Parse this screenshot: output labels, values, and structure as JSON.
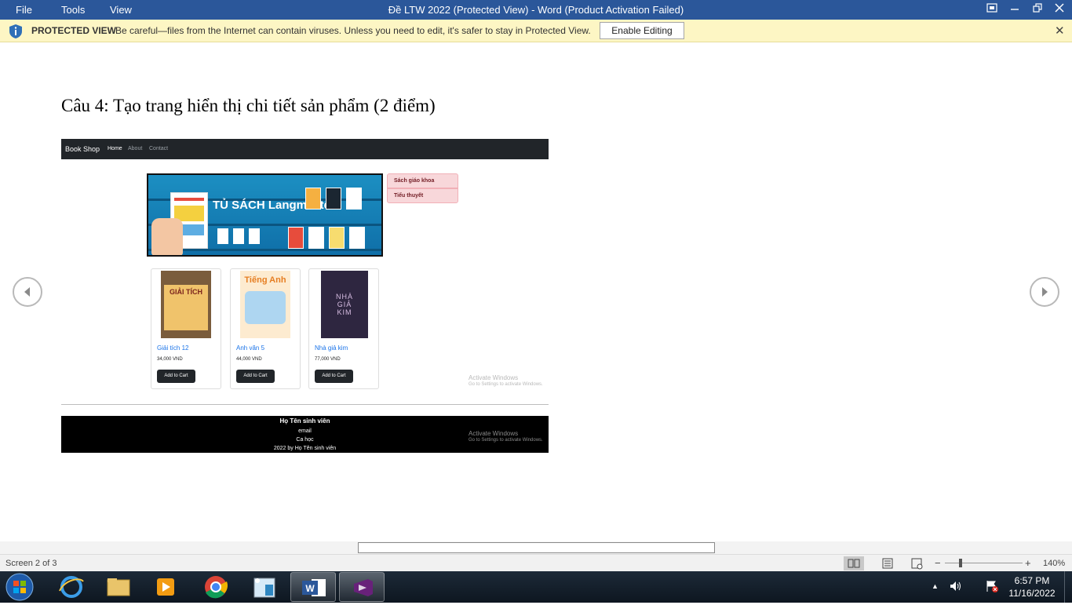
{
  "titlebar": {
    "menu": [
      "File",
      "Tools",
      "View"
    ],
    "title": "Đề LTW 2022 (Protected View) - Word (Product Activation Failed)"
  },
  "protected_view": {
    "label": "PROTECTED VIEW",
    "message": "Be careful—files from the Internet can contain viruses. Unless you need to edit, it's safer to stay in Protected View.",
    "button": "Enable Editing",
    "close": "✕"
  },
  "document": {
    "heading": "Câu 4: Tạo trang hiển thị chi tiết sản phẩm (2 điểm)",
    "embedded_page": {
      "brand": "Book Shop",
      "nav_links": [
        "Home",
        "About",
        "Contact"
      ],
      "banner_text": "TỦ SÁCH Langmaster",
      "categories": [
        "Sách giáo khoa",
        "Tiểu thuyết"
      ],
      "products": [
        {
          "name": "Giải tích 12",
          "price": "34,000 VND",
          "button": "Add to Cart",
          "cover_text": "GIẢI TÍCH"
        },
        {
          "name": "Anh văn 5",
          "price": "44,000 VND",
          "button": "Add to Cart",
          "cover_text": "Tiếng Anh"
        },
        {
          "name": "Nhà giả kim",
          "price": "77,000 VND",
          "button": "Add to Cart",
          "cover_text": "NHÀ GIẢ KIM"
        }
      ],
      "activate": {
        "title": "Activate Windows",
        "sub": "Go to Settings to activate Windows."
      },
      "footer": [
        "Họ Tên sinh viên",
        "email",
        "Ca học",
        "2022 by Họ Tên sinh viên"
      ]
    }
  },
  "status": {
    "screen": "Screen 2 of 3",
    "zoom": "140%",
    "zoom_level": 1.4
  },
  "taskbar": {
    "time": "6:57 PM",
    "date": "11/16/2022"
  },
  "colors": {
    "title_bar": "#2b579a",
    "protected_bar": "#fdf6c4",
    "link_blue": "#1a73e8",
    "dark_nav": "#212529"
  }
}
